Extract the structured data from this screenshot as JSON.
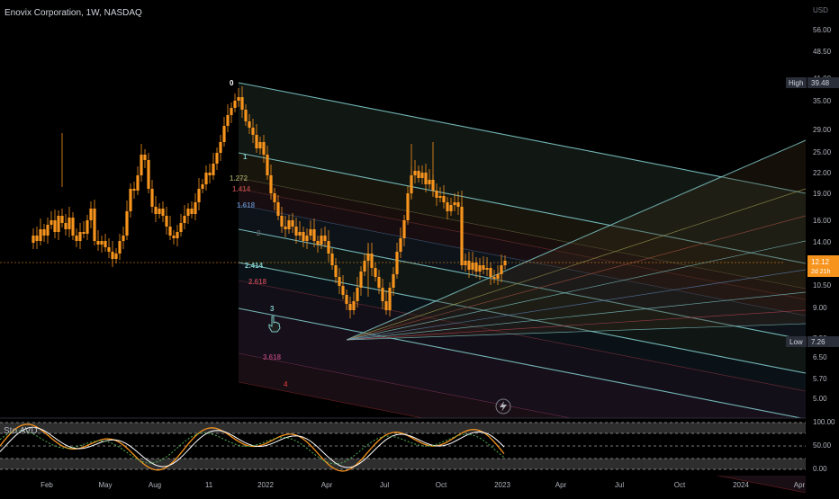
{
  "header": {
    "title": "Enovix Corporation, 1W, NASDAQ"
  },
  "price_scale": {
    "currency": "USD",
    "ticks": [
      "56.00",
      "48.50",
      "41.00",
      "35.00",
      "29.00",
      "25.00",
      "22.00",
      "19.00",
      "16.00",
      "14.00",
      "12.50",
      "10.50",
      "9.00",
      "7.50",
      "6.50",
      "5.70",
      "5.00"
    ],
    "high_label": "High",
    "high_value": "39.48",
    "low_label": "Low",
    "low_value": "7.26",
    "current_price": "12.12",
    "countdown": "2d 21h"
  },
  "time_axis": {
    "labels": [
      "Feb",
      "May",
      "Aug",
      "11",
      "2022",
      "Apr",
      "Jul",
      "Oct",
      "2023",
      "Apr",
      "Jul",
      "Oct",
      "2024",
      "Apr"
    ]
  },
  "fib_levels": [
    "0",
    "1",
    "1.272",
    "1.414",
    "1.618",
    "2",
    "2.414",
    "2.618",
    "3",
    "3.618",
    "4"
  ],
  "oscillator": {
    "name": "Stoch RSI",
    "display_label": "Sto.AVD",
    "scale": [
      "100.00",
      "50.00",
      "0.00"
    ]
  },
  "icons": {
    "flash": "lightning-icon",
    "cursor": "hand-cursor-icon"
  },
  "colors": {
    "background": "#000000",
    "candle": "#f7941d",
    "fib_line": "#7ec8c8",
    "axis_text": "#b2b5be",
    "current_price": "#f7941d",
    "label_bg": "#2a2e39"
  },
  "chart_data": {
    "type": "candlestick",
    "ylim": [
      5.0,
      56.0
    ],
    "y_scale": "log",
    "high": 39.48,
    "low": 7.26,
    "last_close": 12.12
  }
}
